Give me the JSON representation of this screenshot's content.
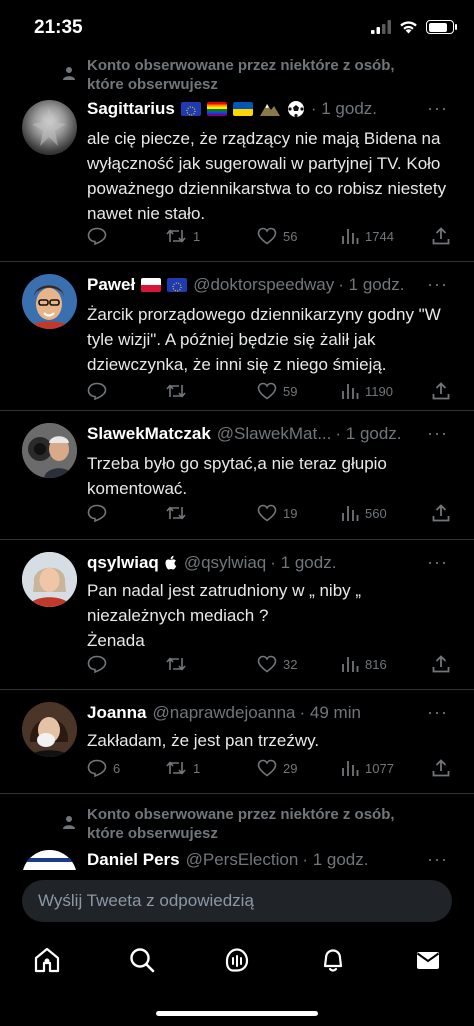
{
  "status_bar": {
    "time": "21:35"
  },
  "social_context": "Konto obserwowane przez niektóre z osób, które obserwujesz",
  "tweets": [
    {
      "name": "Sagittarius",
      "handle": "",
      "time": "1 godz.",
      "text": "ale cię piecze, że rządzący nie mają Bidena na wyłączność jak sugerowali w partyjnej TV.  Koło poważnego dziennikarstwa to co robisz niestety nawet nie stało.",
      "replies": "",
      "retweets": "1",
      "likes": "56",
      "views": "1744"
    },
    {
      "name": "Paweł",
      "handle": "@doktorspeedway",
      "time": "1 godz.",
      "text": "Żarcik prorządowego dziennikarzyny godny \"W tyle wizji\". A później będzie się żalił jak dziewczynka, że inni się z niego śmieją.",
      "replies": "",
      "retweets": "",
      "likes": "59",
      "views": "1190"
    },
    {
      "name": "SlawekMatczak",
      "handle": "@SlawekMat...",
      "time": "1 godz.",
      "text": "Trzeba było go spytać,a nie teraz głupio komentować.",
      "replies": "",
      "retweets": "",
      "likes": "19",
      "views": "560"
    },
    {
      "name": "qsylwiaq",
      "handle": "@qsylwiaq",
      "time": "1 godz.",
      "text": "Pan nadal jest zatrudniony w „ niby „ niezależnych mediach ?\nŻenada",
      "replies": "",
      "retweets": "",
      "likes": "32",
      "views": "816"
    },
    {
      "name": "Joanna",
      "handle": "@naprawdejoanna",
      "time": "49 min",
      "text": "Zakładam, że jest pan trzeźwy.",
      "replies": "6",
      "retweets": "1",
      "likes": "29",
      "views": "1077"
    },
    {
      "name": "Daniel Pers",
      "handle": "@PersElection",
      "time": "1 godz."
    }
  ],
  "reply_placeholder": "Wyślij Tweeta z odpowiedzią",
  "nav": [
    "home-icon",
    "search-icon",
    "spaces-icon",
    "bell-icon",
    "mail-icon"
  ],
  "colors": {
    "background": "#000000",
    "secondary_text": "#71767b",
    "divider": "#2f3336"
  }
}
